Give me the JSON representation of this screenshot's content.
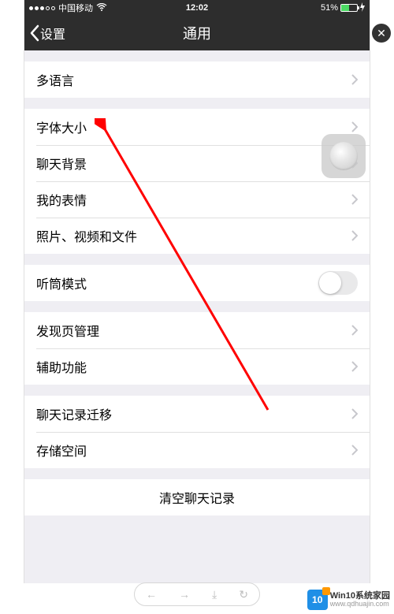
{
  "status_bar": {
    "carrier": "中国移动",
    "wifi_icon": "wifi-icon",
    "time": "12:02",
    "battery_percent": "51%",
    "charging_icon": "bolt-icon"
  },
  "nav": {
    "back_label": "设置",
    "title": "通用"
  },
  "groups": [
    {
      "items": [
        {
          "id": "multilang",
          "label": "多语言",
          "type": "nav"
        }
      ]
    },
    {
      "items": [
        {
          "id": "font-size",
          "label": "字体大小",
          "type": "nav"
        },
        {
          "id": "chat-bg",
          "label": "聊天背景",
          "type": "nav"
        },
        {
          "id": "stickers",
          "label": "我的表情",
          "type": "nav"
        },
        {
          "id": "media",
          "label": "照片、视频和文件",
          "type": "nav"
        }
      ]
    },
    {
      "items": [
        {
          "id": "earpiece",
          "label": "听筒模式",
          "type": "toggle",
          "on": false
        }
      ]
    },
    {
      "items": [
        {
          "id": "discover",
          "label": "发现页管理",
          "type": "nav"
        },
        {
          "id": "access",
          "label": "辅助功能",
          "type": "nav"
        }
      ]
    },
    {
      "items": [
        {
          "id": "migrate",
          "label": "聊天记录迁移",
          "type": "nav"
        },
        {
          "id": "storage",
          "label": "存储空间",
          "type": "nav"
        }
      ]
    },
    {
      "items": [
        {
          "id": "clear",
          "label": "清空聊天记录",
          "type": "button"
        }
      ]
    }
  ],
  "bottom_pill": {
    "prev": "←",
    "next": "→",
    "download": "⤓",
    "refresh": "↻"
  },
  "close_badge": "✕",
  "watermark": {
    "logo_text": "10",
    "cn": "Win10系统家园",
    "url": "www.qdhuajin.com"
  }
}
